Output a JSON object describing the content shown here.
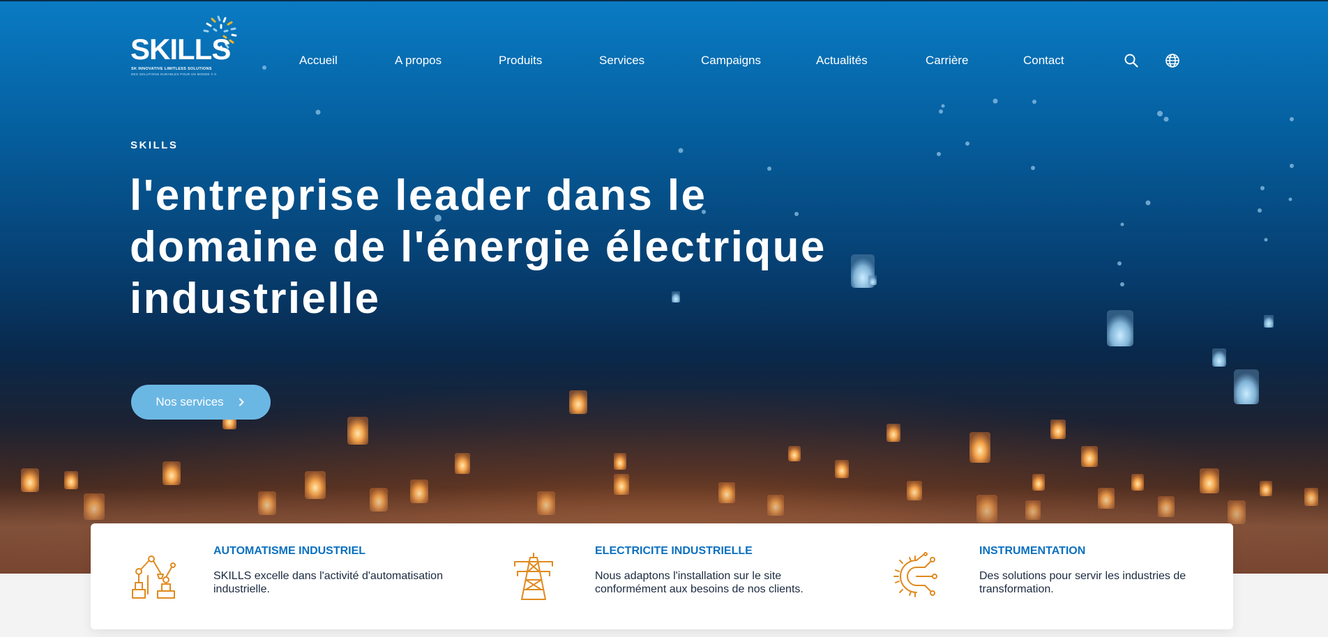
{
  "brand": {
    "logo_word": "SKILLS",
    "logo_tagline": "SK INNOVATIVE LIMITLESS SOLUTIONS",
    "logo_subline": "DES SOLUTIONS DURABLES POUR UN MONDE À 0"
  },
  "nav": {
    "items": [
      {
        "label": "Accueil"
      },
      {
        "label": "A propos"
      },
      {
        "label": "Produits"
      },
      {
        "label": "Services"
      },
      {
        "label": "Campaigns"
      },
      {
        "label": "Actualités"
      },
      {
        "label": "Carrière"
      },
      {
        "label": "Contact"
      }
    ],
    "search_icon": "search-icon",
    "language_icon": "globe-icon"
  },
  "hero": {
    "eyebrow": "SKILLS",
    "headline": "l'entreprise leader dans le domaine de l'énergie électrique industrielle",
    "cta_label": "Nos services",
    "cta_icon": "chevron-right-icon"
  },
  "features": [
    {
      "icon": "robot-arm-icon",
      "title": "AUTOMATISME INDUSTRIEL",
      "text": "SKILLS excelle dans l'activité d'automatisation industrielle."
    },
    {
      "icon": "power-tower-icon",
      "title": "ELECTRICITE INDUSTRIELLE",
      "text": "Nous adaptons l'installation sur le site conformément aux besoins de nos clients."
    },
    {
      "icon": "gear-circuit-icon",
      "title": "INSTRUMENTATION",
      "text": "Des solutions pour servir les industries de transformation."
    }
  ],
  "colors": {
    "accent": "#0a70c0",
    "icon_orange": "#e08a1e",
    "cta_blue": "#6bb7e3",
    "hero_top": "#0a7bc4",
    "hero_mid": "#063d6e"
  }
}
